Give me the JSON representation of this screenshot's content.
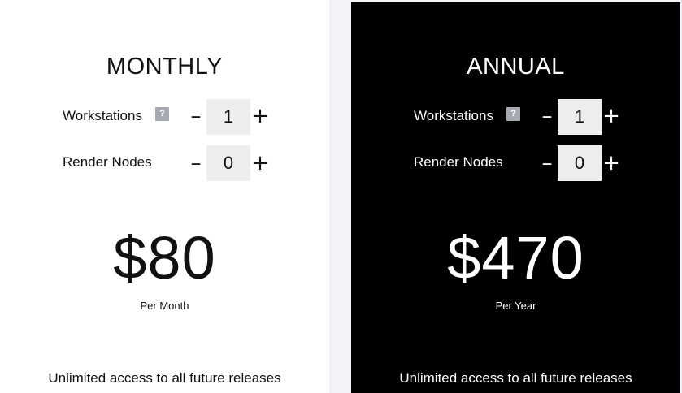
{
  "plans": {
    "monthly": {
      "title": "MONTHLY",
      "workstations": {
        "label": "Workstations",
        "help": "?",
        "minus": "–",
        "plus": "+",
        "value": "1"
      },
      "render_nodes": {
        "label": "Render Nodes",
        "minus": "–",
        "plus": "+",
        "value": "0"
      },
      "price": "$80",
      "period": "Per Month",
      "footer": "Unlimited access to all future releases"
    },
    "annual": {
      "title": "ANNUAL",
      "workstations": {
        "label": "Workstations",
        "help": "?",
        "minus": "–",
        "plus": "+",
        "value": "1"
      },
      "render_nodes": {
        "label": "Render Nodes",
        "minus": "–",
        "plus": "+",
        "value": "0"
      },
      "price": "$470",
      "period": "Per Year",
      "footer": "Unlimited access to all future releases"
    }
  },
  "colors": {
    "monthly_bg": "#ffffff",
    "annual_bg": "#000000",
    "page_bg": "#f1f3f7",
    "value_box": "#eeeeee",
    "help_icon": "#a7a9b0"
  }
}
